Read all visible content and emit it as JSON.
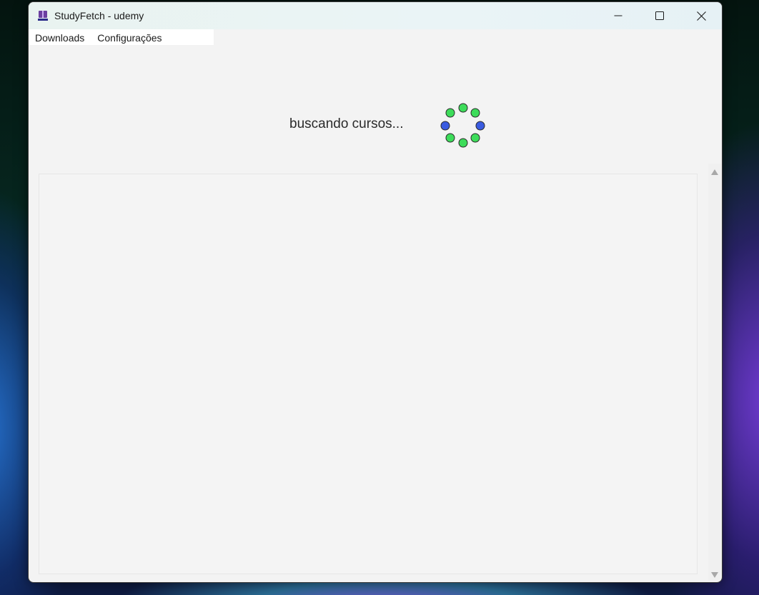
{
  "window": {
    "title": "StudyFetch - udemy"
  },
  "menubar": {
    "items": [
      {
        "label": "Downloads"
      },
      {
        "label": "Configurações"
      }
    ]
  },
  "status": {
    "text": "buscando cursos..."
  },
  "spinner": {
    "active_color": "#3a5be0",
    "inactive_color": "#3ddc5a"
  },
  "icons": [
    "app-icon",
    "minimize-icon",
    "maximize-icon",
    "close-icon",
    "loading-spinner-icon",
    "scroll-up-arrow-icon",
    "scroll-down-arrow-icon"
  ]
}
